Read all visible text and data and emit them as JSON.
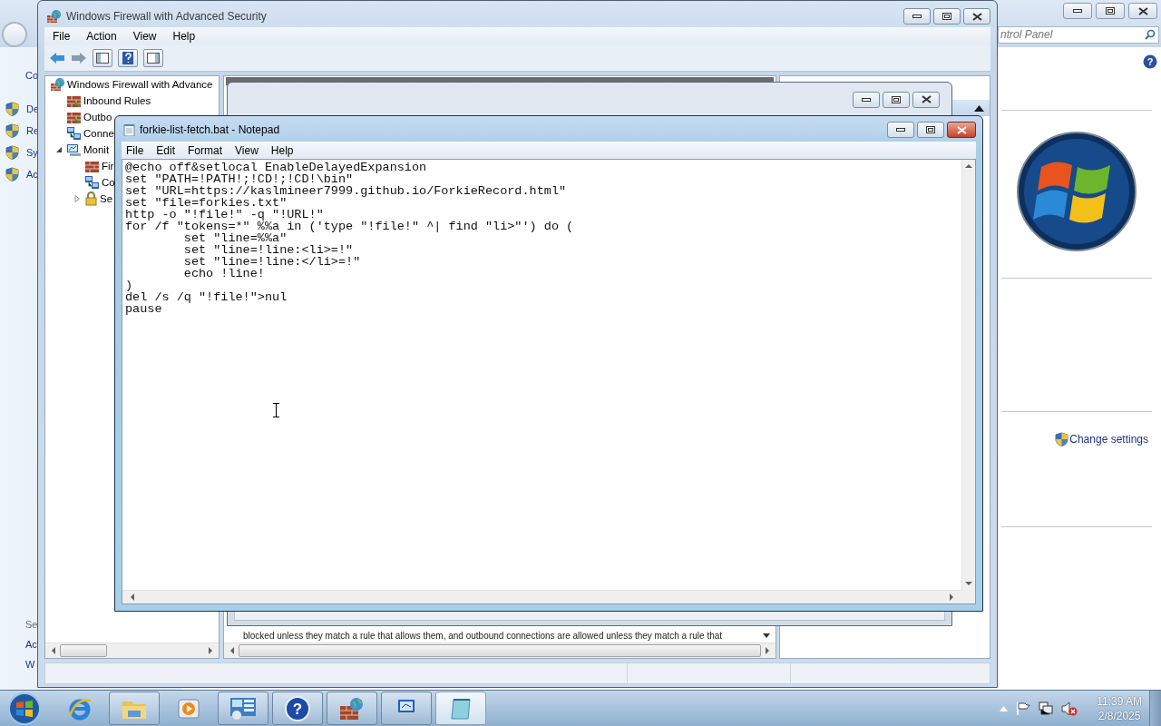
{
  "control_panel": {
    "search": {
      "placeholder": "ntrol Panel"
    },
    "help_glyph": "?",
    "nav_items": [
      {
        "label": "Co",
        "kind": "heading"
      },
      {
        "label": "De",
        "kind": "shield"
      },
      {
        "label": "Re",
        "kind": "shield"
      },
      {
        "label": "Sy",
        "kind": "shield"
      },
      {
        "label": "Ac",
        "kind": "shield"
      }
    ],
    "footer_items": [
      {
        "label": "Se",
        "kind": "heading"
      },
      {
        "label": "Ac",
        "kind": "link"
      },
      {
        "label": "W",
        "kind": "link"
      }
    ],
    "change_settings": "Change settings"
  },
  "firewall": {
    "title": "Windows Firewall with Advanced Security",
    "menu": [
      "File",
      "Action",
      "View",
      "Help"
    ],
    "tree": {
      "label": "Windows Firewall with Advance",
      "kind": "firewall-globe",
      "children": [
        {
          "label": "Inbound Rules",
          "kind": "rules"
        },
        {
          "label": "Outbo",
          "kind": "rules"
        },
        {
          "label": "Conne",
          "kind": "connections"
        },
        {
          "label": "Monit",
          "kind": "monitor",
          "expanded": true,
          "children": [
            {
              "label": "Fir",
              "kind": "wall"
            },
            {
              "label": "Co",
              "kind": "connections"
            },
            {
              "label": "Se",
              "kind": "lock",
              "expanded": false
            }
          ]
        }
      ]
    },
    "description": "blocked unless they match a rule that allows them, and outbound connections are allowed unless they match a rule that"
  },
  "notepad": {
    "title": "forkie-list-fetch.bat - Notepad",
    "menu": [
      "File",
      "Edit",
      "Format",
      "View",
      "Help"
    ],
    "lines": [
      "@echo off&setlocal EnableDelayedExpansion",
      "set \"PATH=!PATH!;!CD!;!CD!\\bin\"",
      "set \"URL=https://kaslmineer7999.github.io/ForkieRecord.html\"",
      "set \"file=forkies.txt\"",
      "http -o \"!file!\" -q \"!URL!\"",
      "for /f \"tokens=*\" %%a in ('type \"!file!\" ^| find \"li>\"') do (",
      "\tset \"line=%%a\"",
      "\tset \"line=!line:<li>=!\"",
      "\tset \"line=!line:</li>=!\"",
      "\techo !line!",
      ")",
      "del /s /q \"!file!\">nul",
      "pause"
    ]
  },
  "taskbar": {
    "items": [
      {
        "kind": "browser",
        "open": false,
        "selected": false
      },
      {
        "kind": "folder",
        "open": true,
        "selected": false
      },
      {
        "kind": "media",
        "open": false,
        "selected": false
      },
      {
        "kind": "control-panel",
        "open": true,
        "selected": false
      },
      {
        "kind": "help",
        "glyph": "?",
        "open": true,
        "selected": false
      },
      {
        "kind": "firewall",
        "open": true,
        "selected": false
      },
      {
        "kind": "network",
        "open": true,
        "selected": false
      },
      {
        "kind": "notepad",
        "open": true,
        "selected": true
      }
    ],
    "clock": {
      "time": "11:39 AM",
      "date": "2/8/2025"
    }
  }
}
